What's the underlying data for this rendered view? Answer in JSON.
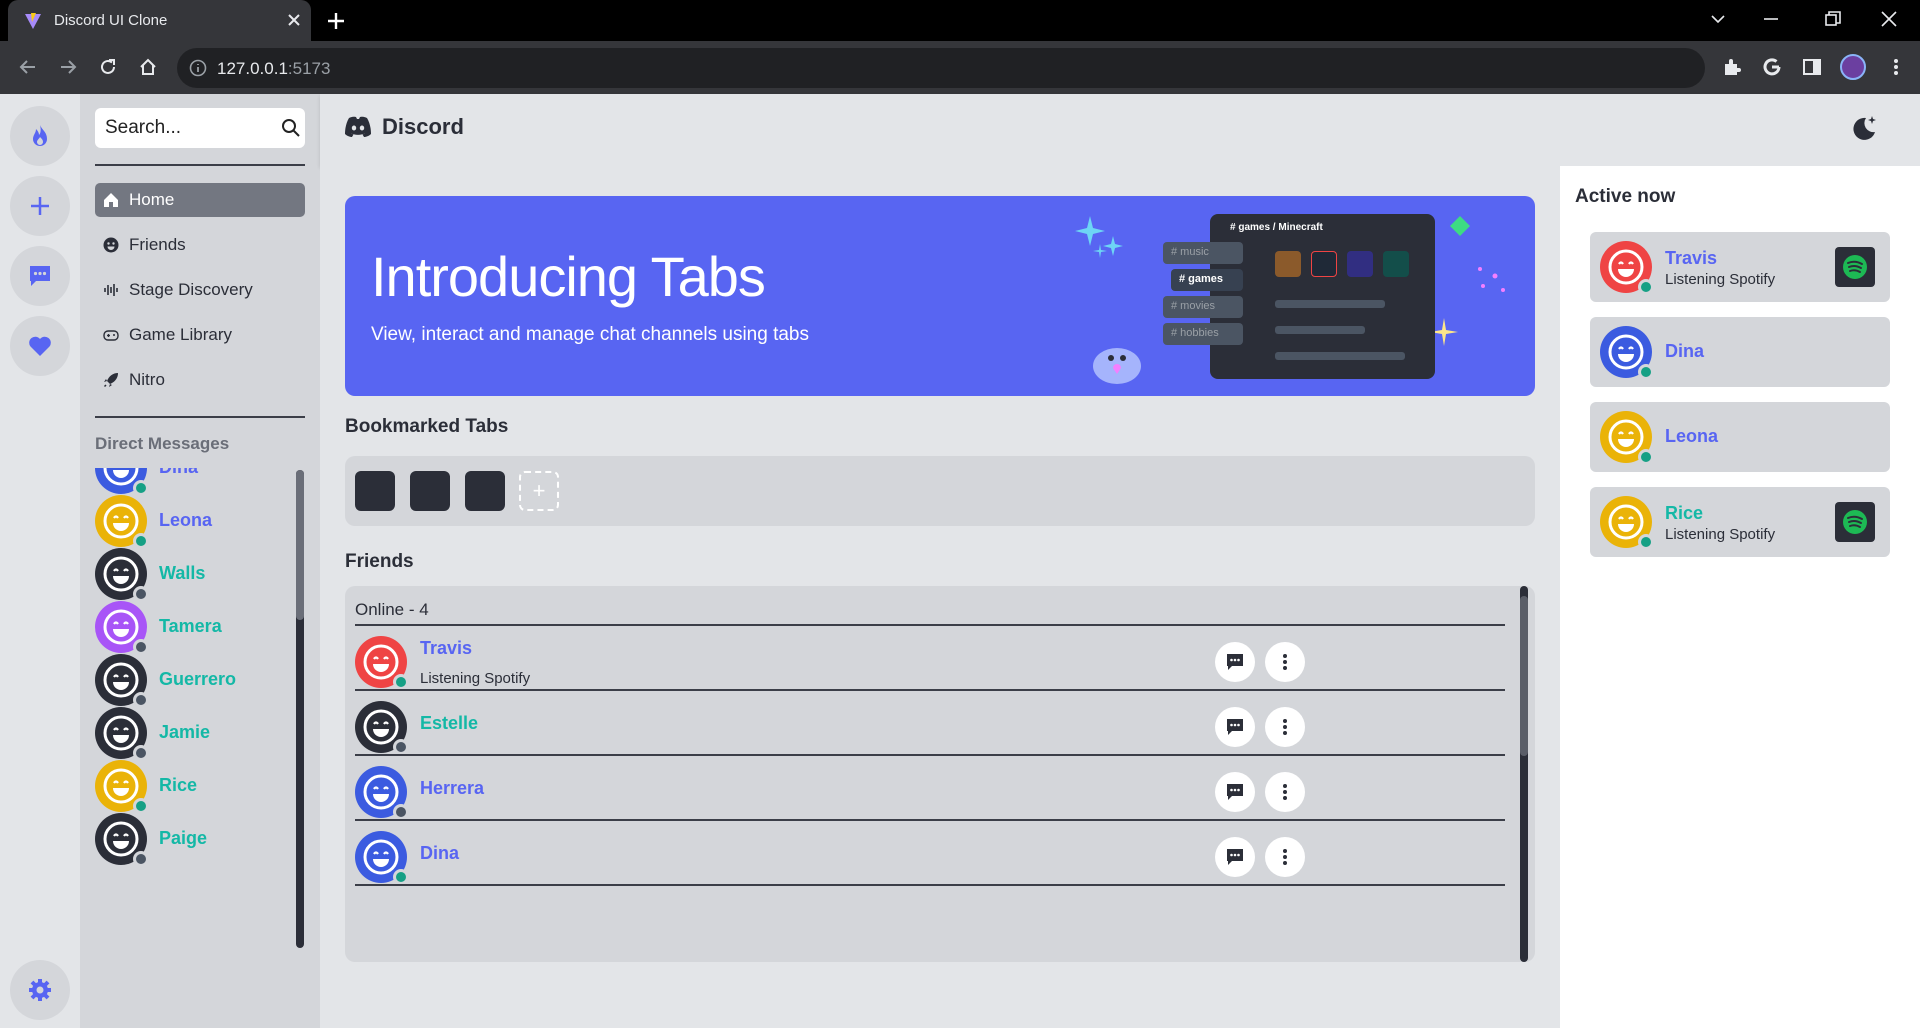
{
  "browser": {
    "tab_title": "Discord UI Clone",
    "url_host": "127.0.0.1",
    "url_port": ":5173"
  },
  "sidebar": {
    "search_placeholder": "Search...",
    "nav": [
      {
        "label": "Home",
        "icon": "home-icon"
      },
      {
        "label": "Friends",
        "icon": "smile-icon"
      },
      {
        "label": "Stage Discovery",
        "icon": "soundwave-icon"
      },
      {
        "label": "Game Library",
        "icon": "gamepad-icon"
      },
      {
        "label": "Nitro",
        "icon": "rocket-icon"
      }
    ],
    "dm_title": "Direct Messages",
    "dms": [
      {
        "name": "Dina",
        "color": "#3b5be0",
        "status": "online"
      },
      {
        "name": "Leona",
        "color": "#eab308",
        "status": "online"
      },
      {
        "name": "Walls",
        "color": "#2b2e38",
        "status": "offline"
      },
      {
        "name": "Tamera",
        "color": "#a855f7",
        "status": "offline"
      },
      {
        "name": "Guerrero",
        "color": "#2b2e38",
        "status": "offline"
      },
      {
        "name": "Jamie",
        "color": "#2b2e38",
        "status": "offline"
      },
      {
        "name": "Rice",
        "color": "#eab308",
        "status": "online"
      },
      {
        "name": "Paige",
        "color": "#2b2e38",
        "status": "offline"
      }
    ]
  },
  "header": {
    "brand": "Discord"
  },
  "banner": {
    "title": "Introducing Tabs",
    "subtitle": "View, interact and manage chat channels using tabs",
    "art_channels": [
      "# music",
      "# games",
      "# movies",
      "# hobbies"
    ],
    "art_header": "# games / Minecraft"
  },
  "bookmarks": {
    "title": "Bookmarked Tabs",
    "add_label": "+"
  },
  "friends": {
    "title": "Friends",
    "online_label": "Online - 4",
    "rows": [
      {
        "name": "Travis",
        "sub": "Listening Spotify",
        "color": "#ef4444",
        "name_color": "#5865f2",
        "status": "online"
      },
      {
        "name": "Estelle",
        "sub": "",
        "color": "#2b2e38",
        "name_color": "#14b8a6",
        "status": "offline"
      },
      {
        "name": "Herrera",
        "sub": "",
        "color": "#3b5be0",
        "name_color": "#5865f2",
        "status": "offline"
      },
      {
        "name": "Dina",
        "sub": "",
        "color": "#3b5be0",
        "name_color": "#5865f2",
        "status": "online"
      }
    ]
  },
  "active_now": {
    "title": "Active now",
    "cards": [
      {
        "name": "Travis",
        "sub": "Listening Spotify",
        "color": "#ef4444",
        "name_color": "#5865f2",
        "spotify": true
      },
      {
        "name": "Dina",
        "sub": "",
        "color": "#3b5be0",
        "name_color": "#5865f2",
        "spotify": false
      },
      {
        "name": "Leona",
        "sub": "",
        "color": "#eab308",
        "name_color": "#5865f2",
        "spotify": false
      },
      {
        "name": "Rice",
        "sub": "Listening Spotify",
        "color": "#eab308",
        "name_color": "#14b8a6",
        "spotify": true
      }
    ]
  },
  "colors": {
    "accent": "#5865f2",
    "online": "#16a085",
    "offline": "#4b5563",
    "teal_name": "#14b8a6"
  }
}
